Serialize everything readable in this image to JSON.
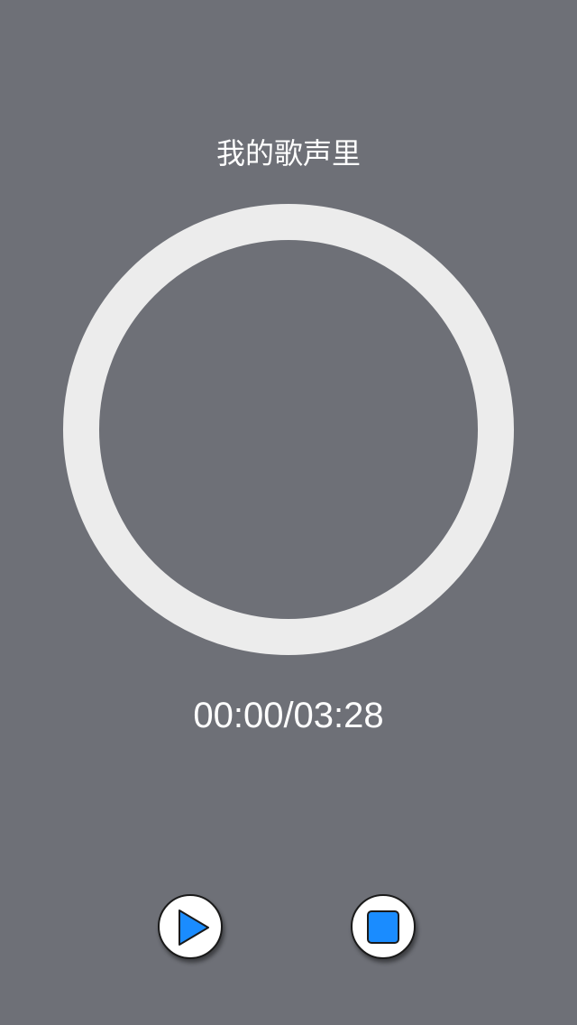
{
  "player": {
    "song_title": "我的歌声里",
    "elapsed_time": "00:00",
    "total_time": "03:28",
    "time_text": "00:00/03:28",
    "progress": 0
  },
  "controls": {
    "play_icon": "play-icon",
    "stop_icon": "stop-icon"
  },
  "colors": {
    "background": "#6e7077",
    "ring": "#ececec",
    "accent": "#1a8cff",
    "text": "#ffffff"
  }
}
